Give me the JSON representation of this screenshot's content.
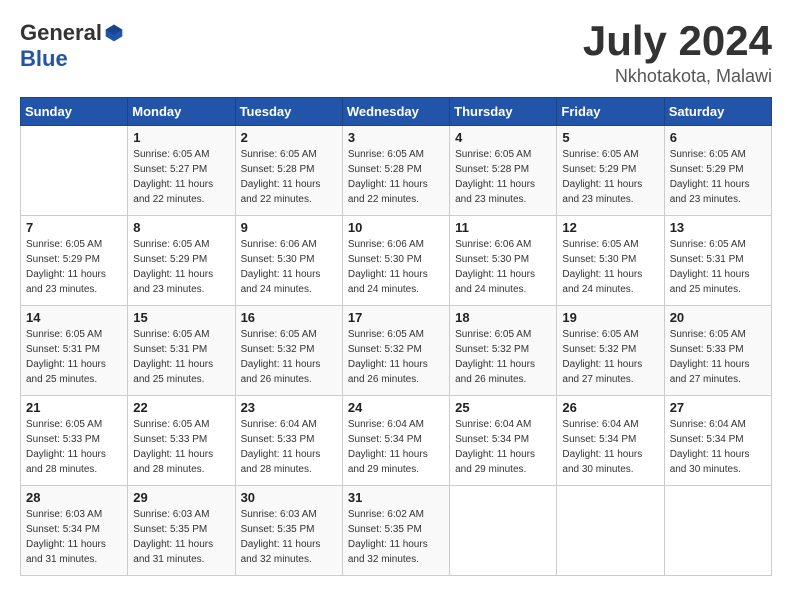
{
  "logo": {
    "general": "General",
    "blue": "Blue"
  },
  "title": {
    "month_year": "July 2024",
    "location": "Nkhotakota, Malawi"
  },
  "weekdays": [
    "Sunday",
    "Monday",
    "Tuesday",
    "Wednesday",
    "Thursday",
    "Friday",
    "Saturday"
  ],
  "weeks": [
    [
      {
        "day": "",
        "info": ""
      },
      {
        "day": "1",
        "info": "Sunrise: 6:05 AM\nSunset: 5:27 PM\nDaylight: 11 hours\nand 22 minutes."
      },
      {
        "day": "2",
        "info": "Sunrise: 6:05 AM\nSunset: 5:28 PM\nDaylight: 11 hours\nand 22 minutes."
      },
      {
        "day": "3",
        "info": "Sunrise: 6:05 AM\nSunset: 5:28 PM\nDaylight: 11 hours\nand 22 minutes."
      },
      {
        "day": "4",
        "info": "Sunrise: 6:05 AM\nSunset: 5:28 PM\nDaylight: 11 hours\nand 23 minutes."
      },
      {
        "day": "5",
        "info": "Sunrise: 6:05 AM\nSunset: 5:29 PM\nDaylight: 11 hours\nand 23 minutes."
      },
      {
        "day": "6",
        "info": "Sunrise: 6:05 AM\nSunset: 5:29 PM\nDaylight: 11 hours\nand 23 minutes."
      }
    ],
    [
      {
        "day": "7",
        "info": "Sunrise: 6:05 AM\nSunset: 5:29 PM\nDaylight: 11 hours\nand 23 minutes."
      },
      {
        "day": "8",
        "info": "Sunrise: 6:05 AM\nSunset: 5:29 PM\nDaylight: 11 hours\nand 23 minutes."
      },
      {
        "day": "9",
        "info": "Sunrise: 6:06 AM\nSunset: 5:30 PM\nDaylight: 11 hours\nand 24 minutes."
      },
      {
        "day": "10",
        "info": "Sunrise: 6:06 AM\nSunset: 5:30 PM\nDaylight: 11 hours\nand 24 minutes."
      },
      {
        "day": "11",
        "info": "Sunrise: 6:06 AM\nSunset: 5:30 PM\nDaylight: 11 hours\nand 24 minutes."
      },
      {
        "day": "12",
        "info": "Sunrise: 6:05 AM\nSunset: 5:30 PM\nDaylight: 11 hours\nand 24 minutes."
      },
      {
        "day": "13",
        "info": "Sunrise: 6:05 AM\nSunset: 5:31 PM\nDaylight: 11 hours\nand 25 minutes."
      }
    ],
    [
      {
        "day": "14",
        "info": "Sunrise: 6:05 AM\nSunset: 5:31 PM\nDaylight: 11 hours\nand 25 minutes."
      },
      {
        "day": "15",
        "info": "Sunrise: 6:05 AM\nSunset: 5:31 PM\nDaylight: 11 hours\nand 25 minutes."
      },
      {
        "day": "16",
        "info": "Sunrise: 6:05 AM\nSunset: 5:32 PM\nDaylight: 11 hours\nand 26 minutes."
      },
      {
        "day": "17",
        "info": "Sunrise: 6:05 AM\nSunset: 5:32 PM\nDaylight: 11 hours\nand 26 minutes."
      },
      {
        "day": "18",
        "info": "Sunrise: 6:05 AM\nSunset: 5:32 PM\nDaylight: 11 hours\nand 26 minutes."
      },
      {
        "day": "19",
        "info": "Sunrise: 6:05 AM\nSunset: 5:32 PM\nDaylight: 11 hours\nand 27 minutes."
      },
      {
        "day": "20",
        "info": "Sunrise: 6:05 AM\nSunset: 5:33 PM\nDaylight: 11 hours\nand 27 minutes."
      }
    ],
    [
      {
        "day": "21",
        "info": "Sunrise: 6:05 AM\nSunset: 5:33 PM\nDaylight: 11 hours\nand 28 minutes."
      },
      {
        "day": "22",
        "info": "Sunrise: 6:05 AM\nSunset: 5:33 PM\nDaylight: 11 hours\nand 28 minutes."
      },
      {
        "day": "23",
        "info": "Sunrise: 6:04 AM\nSunset: 5:33 PM\nDaylight: 11 hours\nand 28 minutes."
      },
      {
        "day": "24",
        "info": "Sunrise: 6:04 AM\nSunset: 5:34 PM\nDaylight: 11 hours\nand 29 minutes."
      },
      {
        "day": "25",
        "info": "Sunrise: 6:04 AM\nSunset: 5:34 PM\nDaylight: 11 hours\nand 29 minutes."
      },
      {
        "day": "26",
        "info": "Sunrise: 6:04 AM\nSunset: 5:34 PM\nDaylight: 11 hours\nand 30 minutes."
      },
      {
        "day": "27",
        "info": "Sunrise: 6:04 AM\nSunset: 5:34 PM\nDaylight: 11 hours\nand 30 minutes."
      }
    ],
    [
      {
        "day": "28",
        "info": "Sunrise: 6:03 AM\nSunset: 5:34 PM\nDaylight: 11 hours\nand 31 minutes."
      },
      {
        "day": "29",
        "info": "Sunrise: 6:03 AM\nSunset: 5:35 PM\nDaylight: 11 hours\nand 31 minutes."
      },
      {
        "day": "30",
        "info": "Sunrise: 6:03 AM\nSunset: 5:35 PM\nDaylight: 11 hours\nand 32 minutes."
      },
      {
        "day": "31",
        "info": "Sunrise: 6:02 AM\nSunset: 5:35 PM\nDaylight: 11 hours\nand 32 minutes."
      },
      {
        "day": "",
        "info": ""
      },
      {
        "day": "",
        "info": ""
      },
      {
        "day": "",
        "info": ""
      }
    ]
  ]
}
